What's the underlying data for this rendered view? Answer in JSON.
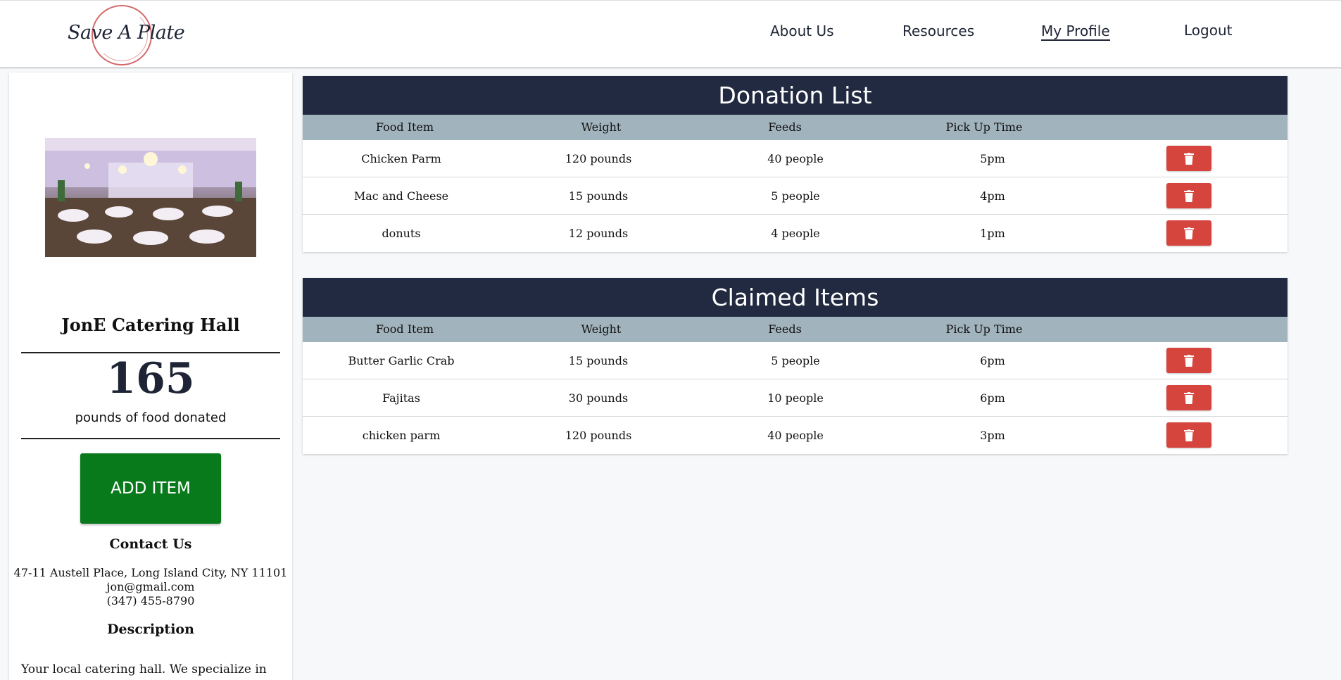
{
  "nav": {
    "logo_text": "Save A Plate",
    "links": [
      {
        "label": "About Us"
      },
      {
        "label": "Resources"
      },
      {
        "label": "My Profile"
      },
      {
        "label": "Logout"
      }
    ]
  },
  "profile": {
    "name": "JonE Catering Hall",
    "donated_count": "165",
    "donated_label": "pounds of food donated",
    "add_item_label": "ADD ITEM",
    "contact_heading": "Contact Us",
    "address": "47-11 Austell Place, Long Island City, NY 11101",
    "email": "jon@gmail.com",
    "phone": "(347) 455-8790",
    "description_heading": "Description",
    "description": "Your local catering hall. We specialize in"
  },
  "table_headers": {
    "food_item": "Food Item",
    "weight": "Weight",
    "feeds": "Feeds",
    "pickup": "Pick Up Time"
  },
  "donation_list": {
    "title": "Donation List",
    "rows": [
      {
        "food": "Chicken Parm",
        "weight": "120 pounds",
        "feeds": "40 people",
        "pickup": "5pm"
      },
      {
        "food": "Mac and Cheese",
        "weight": "15 pounds",
        "feeds": "5 people",
        "pickup": "4pm"
      },
      {
        "food": "donuts",
        "weight": "12 pounds",
        "feeds": "4 people",
        "pickup": "1pm"
      }
    ]
  },
  "claimed_items": {
    "title": "Claimed Items",
    "rows": [
      {
        "food": "Butter Garlic Crab",
        "weight": "15 pounds",
        "feeds": "5 people",
        "pickup": "6pm"
      },
      {
        "food": "Fajitas",
        "weight": "30 pounds",
        "feeds": "10 people",
        "pickup": "6pm"
      },
      {
        "food": "chicken parm",
        "weight": "120 pounds",
        "feeds": "40 people",
        "pickup": "3pm"
      }
    ]
  },
  "colors": {
    "navy": "#212a40",
    "table_header": "#a1b3bc",
    "delete_red": "#d6453d",
    "add_green": "#087a1c",
    "logo_ring": "#d46a6a"
  },
  "icons": {
    "delete": "trash-icon",
    "venue_photo": "banquet-hall-photo"
  }
}
